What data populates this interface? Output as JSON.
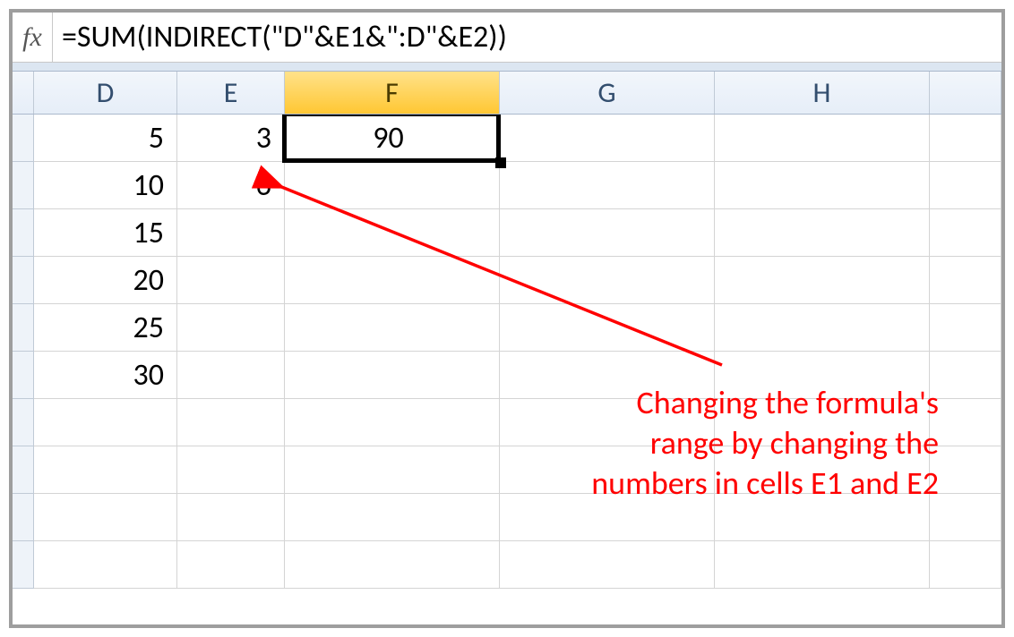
{
  "formula_bar": {
    "fx_label": "fx",
    "formula": "=SUM(INDIRECT(\"D\"&E1&\":D\"&E2))"
  },
  "columns": {
    "D": "D",
    "E": "E",
    "F": "F",
    "G": "G",
    "H": "H"
  },
  "selected_cell": "F1",
  "grid": {
    "D": [
      "5",
      "10",
      "15",
      "20",
      "25",
      "30",
      "",
      "",
      "",
      ""
    ],
    "E": [
      "3",
      "6",
      "",
      "",
      "",
      "",
      "",
      "",
      "",
      ""
    ],
    "F": [
      "90",
      "",
      "",
      "",
      "",
      "",
      "",
      "",
      "",
      ""
    ],
    "G": [
      "",
      "",
      "",
      "",
      "",
      "",
      "",
      "",
      "",
      ""
    ],
    "H": [
      "",
      "",
      "",
      "",
      "",
      "",
      "",
      "",
      "",
      ""
    ]
  },
  "annotation": {
    "line1": "Changing the formula's",
    "line2": "range by changing the",
    "line3": "numbers in cells E1 and E2"
  }
}
